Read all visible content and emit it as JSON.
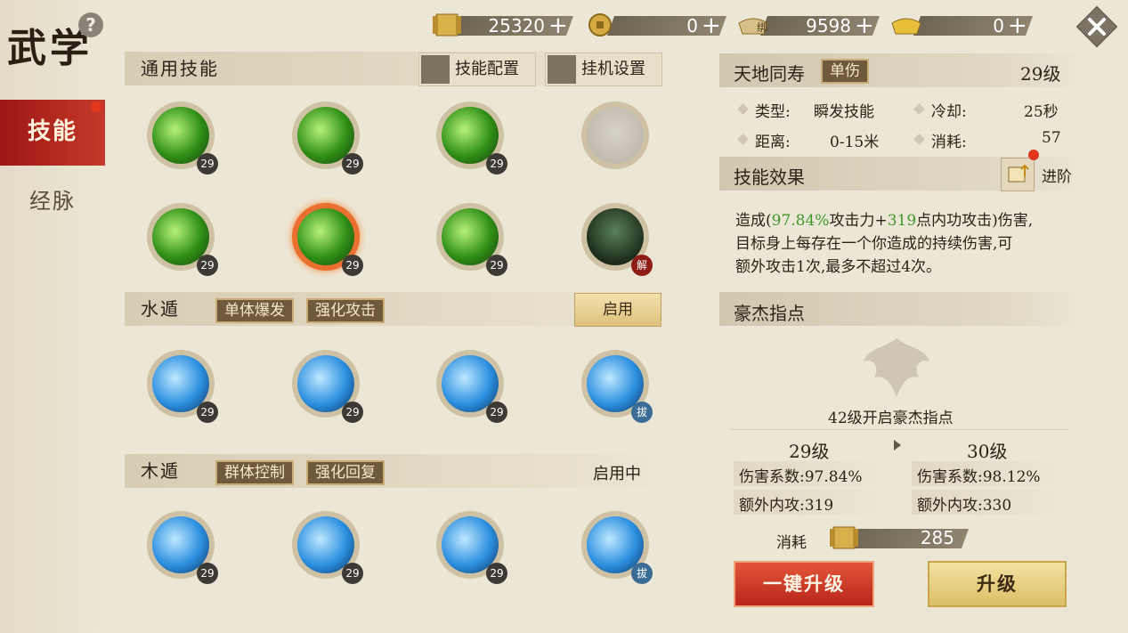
{
  "page": {
    "title": "武学",
    "help_label": "?"
  },
  "tabs": [
    {
      "label": "技能"
    },
    {
      "label": "经脉"
    }
  ],
  "currencies": [
    {
      "icon": "gold-scroll-icon",
      "value": "25320",
      "plus": "+"
    },
    {
      "icon": "copper-coin-icon",
      "value": "0",
      "plus": "+"
    },
    {
      "icon": "bound-ingot-icon",
      "badge": "绑",
      "value": "9598",
      "plus": "+"
    },
    {
      "icon": "gold-ingot-icon",
      "value": "0",
      "plus": "+"
    }
  ],
  "general": {
    "title": "通用技能",
    "config_label": "技能配置",
    "idle_label": "挂机设置",
    "skills": [
      {
        "icon": "spider-skill-icon",
        "style": "green",
        "level": "29"
      },
      {
        "icon": "serpent-skill-icon",
        "style": "green",
        "level": "29"
      },
      {
        "icon": "skulls-skill-icon",
        "style": "green",
        "level": "29"
      },
      {
        "icon": "locked-skill-icon",
        "style": "grey",
        "level": ""
      },
      {
        "icon": "figure-skill-icon",
        "style": "green",
        "level": "29"
      },
      {
        "icon": "lightning-skill-icon",
        "style": "green sel",
        "level": "29"
      },
      {
        "icon": "arms-raised-skill-icon",
        "style": "green",
        "level": "29"
      },
      {
        "icon": "warrior-skill-icon",
        "style": "dark",
        "level": "解",
        "badge": "red"
      }
    ]
  },
  "water": {
    "title": "水遁",
    "tags": [
      "单体爆发",
      "强化攻击"
    ],
    "enable_label": "启用",
    "skills": [
      {
        "icon": "claw-skill-icon",
        "level": "29"
      },
      {
        "icon": "palm-skill-icon",
        "level": "29"
      },
      {
        "icon": "ribcage-skill-icon",
        "level": "29"
      },
      {
        "icon": "skull-skill-icon",
        "level": "拔",
        "badge": "blue"
      }
    ]
  },
  "wood": {
    "title": "木遁",
    "tags": [
      "群体控制",
      "强化回复"
    ],
    "status_label": "启用中",
    "skills": [
      {
        "icon": "toad-skill-icon",
        "level": "29"
      },
      {
        "icon": "scorpion-skill-icon",
        "level": "29"
      },
      {
        "icon": "frog-skill-icon",
        "level": "29"
      },
      {
        "icon": "mask-skill-icon",
        "level": "拔",
        "badge": "blue"
      }
    ]
  },
  "detail": {
    "name": "天地同寿",
    "name_tag": "单伤",
    "level": "29级",
    "type_label": "类型:",
    "type_value": "瞬发技能",
    "cooldown_label": "冷却:",
    "cooldown_value": "25秒",
    "range_label": "距离:",
    "range_value": "0-15米",
    "cost_label": "消耗:",
    "cost_value": "57",
    "effect_title": "技能效果",
    "advance_label": "进阶",
    "effect_pre": "造成(",
    "effect_pct": "97.84%",
    "effect_mid1": "攻击力+",
    "effect_flat": "319",
    "effect_mid2": "点内功攻击)伤害,",
    "effect_line2": "目标身上每存在一个你造成的持续伤害,可",
    "effect_line3": "额外攻击1次,最多不超过4次。",
    "hero_title": "豪杰指点",
    "hero_unlock": "42级开启豪杰指点",
    "cur_level": "29级",
    "next_level": "30级",
    "cur_coef": "伤害系数:97.84%",
    "next_coef": "伤害系数:98.12%",
    "cur_extra": "额外内攻:319",
    "next_extra": "额外内攻:330",
    "upgrade_cost_label": "消耗",
    "upgrade_cost": "285",
    "one_key_label": "一键升级",
    "upgrade_label": "升级"
  },
  "colors": {
    "accent_red": "#b9261a",
    "gold": "#dcbf68",
    "green_text": "#3f9a2a"
  }
}
